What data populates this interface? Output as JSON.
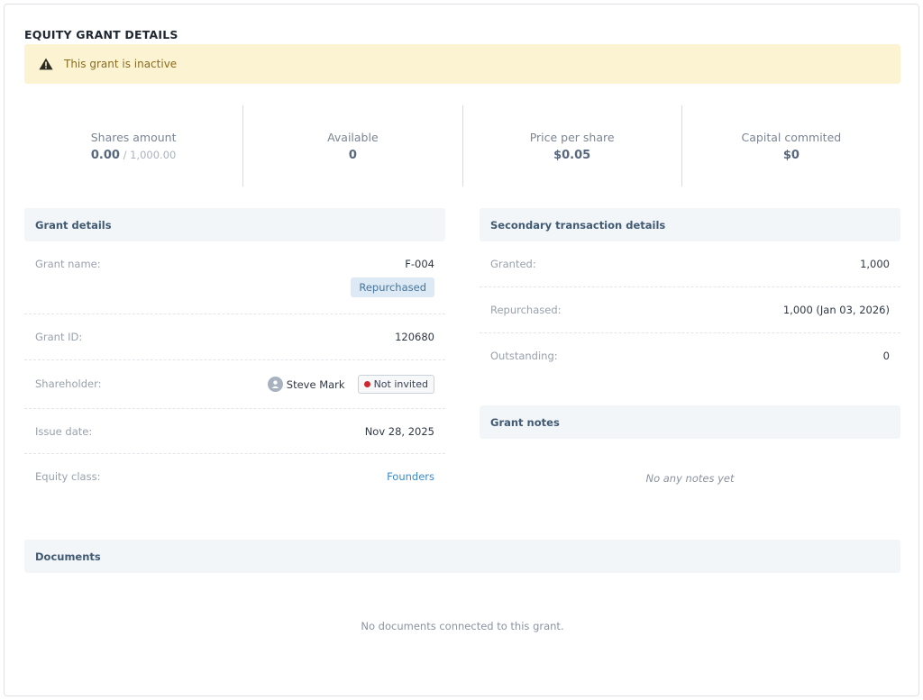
{
  "page": {
    "title": "EQUITY GRANT DETAILS"
  },
  "alert": {
    "text": "This grant is inactive",
    "icon": "warning-icon",
    "color": "#fcf3d3"
  },
  "stats": {
    "shares_amount": {
      "label": "Shares amount",
      "value": "0.00",
      "sub": " / 1,000.00"
    },
    "available": {
      "label": "Available",
      "value": "0"
    },
    "price_per_share": {
      "label": "Price per share",
      "value": "$0.05"
    },
    "capital_committed": {
      "label": "Capital commited",
      "value": "$0"
    }
  },
  "grant_details": {
    "title": "Grant details",
    "grant_name": {
      "label": "Grant name:",
      "value": "F-004",
      "badge": "Repurchased"
    },
    "grant_id": {
      "label": "Grant ID:",
      "value": "120680"
    },
    "shareholder": {
      "label": "Shareholder:",
      "name": "Steve Mark",
      "status": "Not invited"
    },
    "issue_date": {
      "label": "Issue date:",
      "value": "Nov 28, 2025"
    },
    "equity_class": {
      "label": "Equity class:",
      "value": "Founders"
    }
  },
  "secondary": {
    "title": "Secondary transaction details",
    "granted": {
      "label": "Granted:",
      "value": "1,000"
    },
    "repurchased": {
      "label": "Repurchased:",
      "value": "1,000 (Jan 03, 2026)"
    },
    "outstanding": {
      "label": "Outstanding:",
      "value": "0"
    }
  },
  "notes": {
    "title": "Grant notes",
    "empty": "No any notes yet"
  },
  "documents": {
    "title": "Documents",
    "empty": "No documents connected to this grant."
  }
}
